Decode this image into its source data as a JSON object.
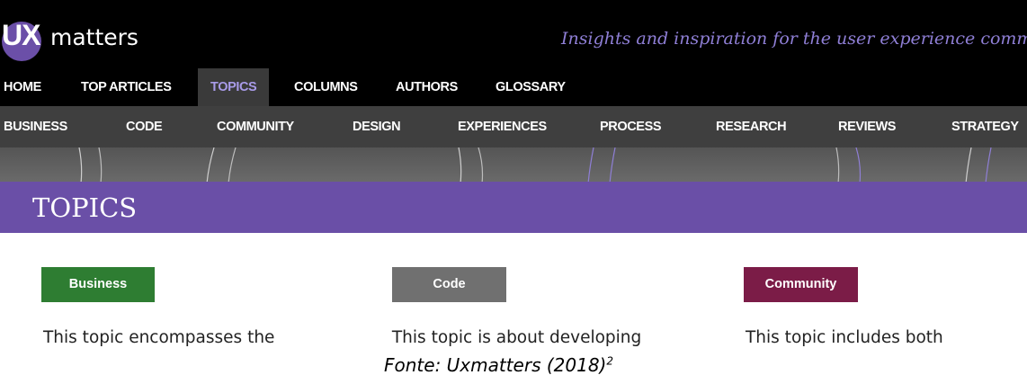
{
  "brand": {
    "logo_ux": "UX",
    "logo_matters": "matters",
    "logo_color": "#6b4fa8",
    "tagline": "Insights and inspiration for the user experience comm"
  },
  "main_nav": {
    "items": [
      "HOME",
      "TOP ARTICLES",
      "TOPICS",
      "COLUMNS",
      "AUTHORS",
      "GLOSSARY"
    ],
    "active": "TOPICS"
  },
  "topic_nav": {
    "items": [
      "BUSINESS",
      "CODE",
      "COMMUNITY",
      "DESIGN",
      "EXPERIENCES",
      "PROCESS",
      "RESEARCH",
      "REVIEWS",
      "STRATEGY"
    ]
  },
  "page": {
    "title": "TOPICS",
    "header_color": "#6a4fa7"
  },
  "topics": [
    {
      "label": "Business",
      "color": "#2e7d32",
      "description": "This topic encompasses the"
    },
    {
      "label": "Code",
      "color": "#707070",
      "description": " This topic is about developing"
    },
    {
      "label": "Community",
      "color": "#7b1c47",
      "description": "This topic includes both"
    }
  ],
  "caption": {
    "text": "Fonte: Uxmatters (2018)",
    "superscript": "2"
  }
}
